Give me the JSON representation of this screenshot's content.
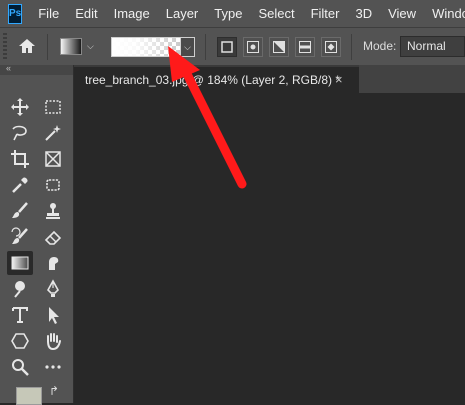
{
  "app": {
    "logo_text": "Ps"
  },
  "menu": {
    "items": [
      "File",
      "Edit",
      "Image",
      "Layer",
      "Type",
      "Select",
      "Filter",
      "3D",
      "View",
      "Window"
    ]
  },
  "options_bar": {
    "mode_label": "Mode:",
    "mode_value": "Normal",
    "gradient_types": [
      "linear-gradient",
      "radial-gradient",
      "angle-gradient",
      "reflected-gradient",
      "diamond-gradient"
    ],
    "active_gradient_type": "linear-gradient"
  },
  "document": {
    "tab_title": "tree_branch_03.jpg @ 184% (Layer 2, RGB/8) *",
    "close_glyph": "×"
  },
  "toolbar": {
    "collapse_glyph": "«",
    "tools": [
      "move-tool-icon",
      "marquee-tool-icon",
      "lasso-tool-icon",
      "magic-wand-icon",
      "crop-tool-icon",
      "frame-tool-icon",
      "eyedropper-icon",
      "patch-tool-icon",
      "brush-tool-icon",
      "clone-stamp-icon",
      "history-brush-icon",
      "eraser-icon",
      "gradient-tool-icon",
      "smudge-tool-icon",
      "dodge-tool-icon",
      "pen-tool-icon",
      "type-tool-icon",
      "path-selection-icon",
      "shape-tool-icon",
      "hand-tool-icon",
      "zoom-tool-icon",
      "more-tools-icon"
    ],
    "active_tool": "gradient-tool-icon",
    "foreground_color": "#c6c8b8"
  },
  "annotation": {
    "arrow_color": "#ff1a1a"
  }
}
